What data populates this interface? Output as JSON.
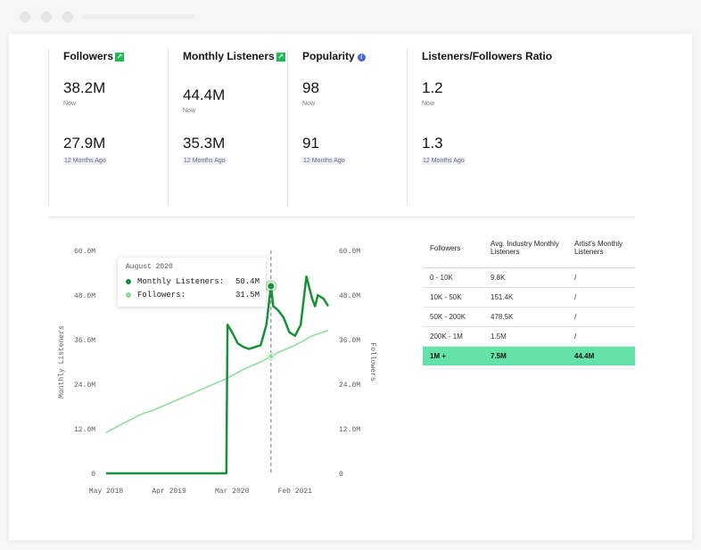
{
  "stats": [
    {
      "title": "Followers",
      "badge": "↗",
      "now_value": "38.2M",
      "now_label": "Now",
      "ago_value": "27.9M",
      "ago_label": "12 Months Ago"
    },
    {
      "title": "Monthly Listeners",
      "badge": "↗",
      "now_value": "44.4M",
      "now_label": "Now",
      "ago_value": "35.3M",
      "ago_label": "12 Months Ago"
    },
    {
      "title": "Popularity",
      "badge": "i",
      "now_value": "98",
      "now_label": "Now",
      "ago_value": "91",
      "ago_label": "12 Months Ago"
    },
    {
      "title": "Listeners/Followers Ratio",
      "badge": "",
      "now_value": "1.2",
      "now_label": "Now",
      "ago_value": "1.3",
      "ago_label": "12 Months Ago"
    }
  ],
  "tooltip": {
    "date": "August 2020",
    "rows": [
      {
        "label": "Monthly Listeners:",
        "value": "50.4M",
        "color": "#1a8f3a"
      },
      {
        "label": "Followers:",
        "value": "31.5M",
        "color": "#8ddc9c"
      }
    ]
  },
  "table": {
    "headers": [
      "Followers",
      "Avg. Industry Monthly Listeners",
      "Artist's Monthly Listeners"
    ],
    "rows": [
      [
        "0 - 10K",
        "9.8K",
        "/"
      ],
      [
        "10K - 50K",
        "151.4K",
        "/"
      ],
      [
        "50K - 200K",
        "478.5K",
        "/"
      ],
      [
        "200K - 1M",
        "1.5M",
        "/"
      ],
      [
        "1M +",
        "7.5M",
        "44.4M"
      ]
    ],
    "highlight_color": "#64e3a8"
  },
  "chart_data": {
    "type": "line",
    "ylabel": "Monthly Listeners",
    "ylabel_right": "Followers",
    "y_ticks": [
      "0",
      "12.0M",
      "24.0M",
      "36.0M",
      "48.0M",
      "60.0M"
    ],
    "ylim": [
      0,
      60
    ],
    "x_ticks": [
      "May 2018",
      "Apr 2019",
      "Mar 2020",
      "Feb 2021"
    ],
    "grid": false,
    "colors": {
      "listeners": "#1a8f3a",
      "followers": "#8ddc9c"
    },
    "series": [
      {
        "name": "Monthly Listeners",
        "x_months": [
          0,
          6,
          12,
          18,
          21,
          21.2,
          22,
          23,
          24,
          25,
          26,
          27,
          28,
          28.8,
          29.2,
          30,
          31,
          32,
          33,
          34,
          35,
          36,
          36.5,
          37,
          38,
          38.8
        ],
        "values": [
          0,
          0,
          0,
          0,
          0,
          40.0,
          38.0,
          35.0,
          34.0,
          33.5,
          34.0,
          34.5,
          40.0,
          50.4,
          45.0,
          44.0,
          42.0,
          38.0,
          37.0,
          40.0,
          53.0,
          47.0,
          45.0,
          48.0,
          47.0,
          45.0
        ]
      },
      {
        "name": "Followers",
        "x_months": [
          0,
          3,
          6,
          9,
          12,
          15,
          18,
          21,
          24,
          27,
          28.8,
          30,
          33,
          36,
          38.8
        ],
        "values": [
          11.0,
          13.5,
          15.8,
          17.5,
          19.5,
          21.5,
          23.5,
          25.5,
          28.0,
          30.0,
          31.5,
          32.5,
          34.5,
          37.0,
          38.5
        ]
      }
    ],
    "marker_month": 28.8
  }
}
